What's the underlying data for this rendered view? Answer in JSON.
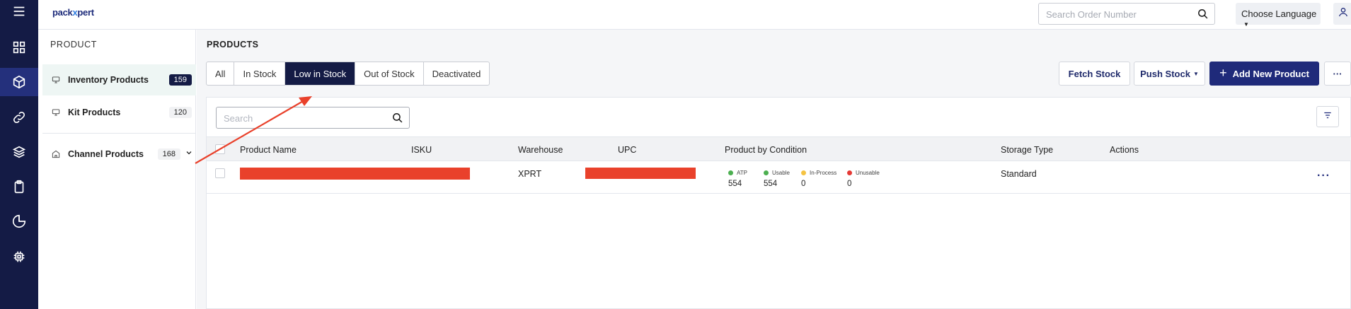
{
  "brand": {
    "logo_part1": "pack",
    "logo_part2": "x",
    "logo_part3": "pert"
  },
  "rail": {
    "icons": [
      "menu-icon",
      "dashboard-icon",
      "box-icon",
      "link-icon",
      "layers-icon",
      "clipboard-icon",
      "pie-chart-icon",
      "chip-icon"
    ],
    "active": "box-icon"
  },
  "header": {
    "search_placeholder": "Search Order Number",
    "language_label": "Choose Language"
  },
  "sidebar": {
    "heading": "PRODUCT",
    "items": [
      {
        "label": "Inventory Products",
        "count": "159",
        "active": true
      },
      {
        "label": "Kit Products",
        "count": "120",
        "active": false
      },
      {
        "label": "Channel Products",
        "count": "168",
        "active": false
      }
    ]
  },
  "page": {
    "title": "PRODUCTS",
    "tabs": [
      {
        "label": "All",
        "active": false
      },
      {
        "label": "In Stock",
        "active": false
      },
      {
        "label": "Low in Stock",
        "active": true
      },
      {
        "label": "Out of Stock",
        "active": false
      },
      {
        "label": "Deactivated",
        "active": false
      }
    ],
    "actions": {
      "fetch": "Fetch Stock",
      "push": "Push Stock",
      "add": "Add New Product",
      "more": "···"
    }
  },
  "table": {
    "search_placeholder": "Search",
    "columns": [
      "Product Name",
      "ISKU",
      "Warehouse",
      "UPC",
      "Product by Condition",
      "Storage Type",
      "Actions"
    ],
    "rows": [
      {
        "warehouse": "XPRT",
        "storage_type": "Standard",
        "conditions": [
          {
            "label": "ATP",
            "value": "554",
            "color": "#4caf50"
          },
          {
            "label": "Usable",
            "value": "554",
            "color": "#4caf50"
          },
          {
            "label": "In-Process",
            "value": "0",
            "color": "#f5c342"
          },
          {
            "label": "Unusable",
            "value": "0",
            "color": "#e53935"
          }
        ]
      }
    ]
  },
  "colors": {
    "rail": "#141b45",
    "primary": "#1f2a7a",
    "redaction": "#e9412b",
    "annotation": "#e9412b"
  }
}
